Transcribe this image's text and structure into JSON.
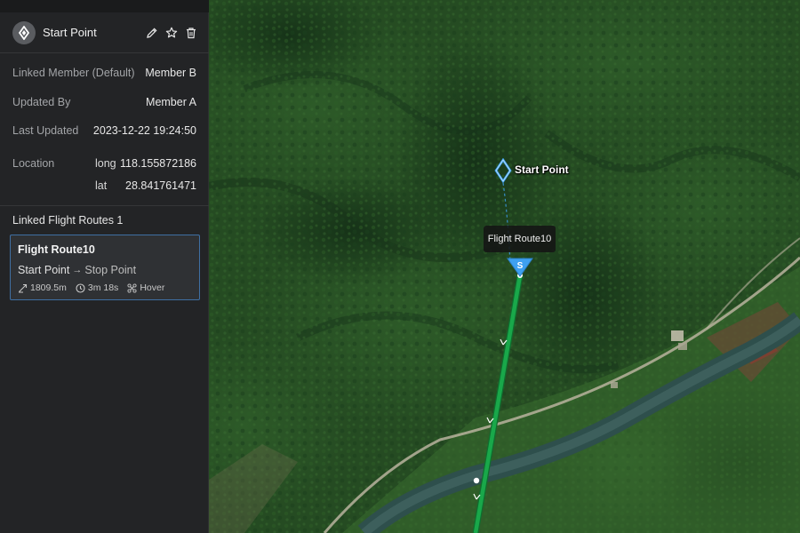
{
  "header": {
    "title": "Start Point",
    "icons": [
      "marker-diamond-icon",
      "edit-icon",
      "star-icon",
      "trash-icon"
    ]
  },
  "info": {
    "linked_member": {
      "label": "Linked Member (Default)",
      "value": "Member B"
    },
    "updated_by": {
      "label": "Updated By",
      "value": "Member A"
    },
    "last_updated": {
      "label": "Last Updated",
      "value": "2023-12-22 19:24:50"
    },
    "location": {
      "label": "Location",
      "long_label": "long",
      "long_value": "118.155872186",
      "lat_label": "lat",
      "lat_value": "28.841761471"
    }
  },
  "routes": {
    "title": "Linked Flight Routes 1",
    "items": [
      {
        "name": "Flight Route10",
        "start": "Start Point",
        "stop": "Stop Point",
        "distance": "1809.5m",
        "duration": "3m 18s",
        "action": "Hover"
      }
    ]
  },
  "map": {
    "marker_label": "Start Point",
    "tooltip": "Flight Route10",
    "start_badge": "S",
    "colors": {
      "route": "#19a84a",
      "marker": "#3ea0f0",
      "accent": "#3f6fa3"
    }
  }
}
